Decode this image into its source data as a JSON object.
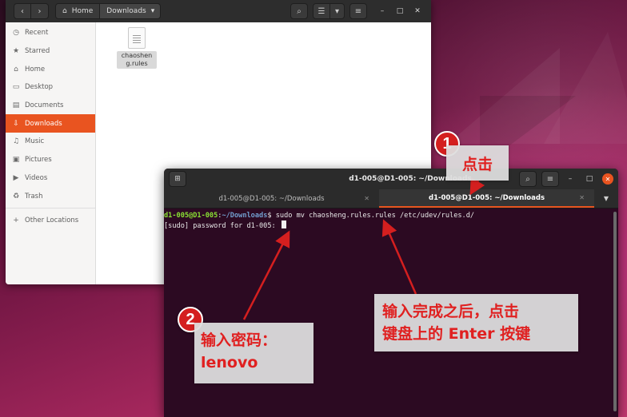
{
  "files": {
    "breadcrumb_home": "Home",
    "breadcrumb_current": "Downloads",
    "sidebar": [
      {
        "icon": "clock-icon",
        "glyph": "◷",
        "label": "Recent"
      },
      {
        "icon": "star-icon",
        "glyph": "★",
        "label": "Starred"
      },
      {
        "icon": "home-icon",
        "glyph": "⌂",
        "label": "Home"
      },
      {
        "icon": "desktop-icon",
        "glyph": "▭",
        "label": "Desktop"
      },
      {
        "icon": "document-icon",
        "glyph": "▤",
        "label": "Documents"
      },
      {
        "icon": "download-icon",
        "glyph": "⇩",
        "label": "Downloads"
      },
      {
        "icon": "music-icon",
        "glyph": "♫",
        "label": "Music"
      },
      {
        "icon": "picture-icon",
        "glyph": "▣",
        "label": "Pictures"
      },
      {
        "icon": "video-icon",
        "glyph": "▶",
        "label": "Videos"
      },
      {
        "icon": "trash-icon",
        "glyph": "♻",
        "label": "Trash"
      }
    ],
    "other_locations": "Other Locations",
    "file": {
      "name": "chaosheng.rules"
    }
  },
  "terminal": {
    "title": "d1-005@D1-005: ~/Downloads",
    "tabs": [
      {
        "label": "d1-005@D1-005: ~/Downloads",
        "active": false
      },
      {
        "label": "d1-005@D1-005: ~/Downloads",
        "active": true
      }
    ],
    "line1": {
      "user": "d1-005@D1-005",
      "sep": ":",
      "path": "~/Downloads",
      "command": "$ sudo mv chaosheng.rules.rules /etc/udev/rules.d/"
    },
    "line2": "[sudo] password for d1-005: "
  },
  "annotations": {
    "badge1": "1",
    "badge2": "2",
    "callout1": "点击",
    "callout2_line1": "输入密码：",
    "callout2_line2": "lenovo",
    "callout3_line1": "输入完成之后，点击",
    "callout3_line2": "键盘上的 Enter 按键",
    "color": "#e02020"
  },
  "colors": {
    "accent": "#e95420",
    "terminal_bg": "#2c0a22",
    "prompt_user": "#8ae234",
    "prompt_path": "#729fcf"
  }
}
